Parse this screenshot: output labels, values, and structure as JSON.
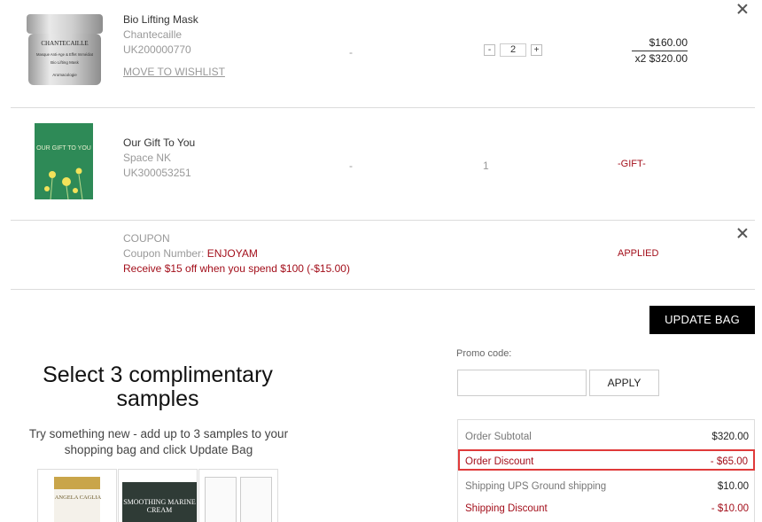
{
  "items": [
    {
      "name": "Bio Lifting Mask",
      "brand": "Chantecaille",
      "sku": "UK200000770",
      "wishlist_link": "MOVE TO WISHLIST",
      "dash": "-",
      "qty_minus": "-",
      "qty": "2",
      "qty_plus": "+",
      "unit_price": "$160.00",
      "total_price": "x2 $320.00",
      "jar_brand": "CHANTECAILLE",
      "jar_text1": "Masque Anti-Age & Effet Immédiat",
      "jar_text2": "Bio Lifting Mask",
      "jar_text3": "Aromacologie"
    },
    {
      "name": "Our Gift To You",
      "brand": "Space NK",
      "sku": "UK300053251",
      "dash": "-",
      "qty": "1",
      "price_label": "-GIFT-",
      "card_text": "OUR GIFT TO YOU"
    }
  ],
  "coupon": {
    "title": "COUPON",
    "number_label": "Coupon Number: ",
    "number": "ENJOYAM",
    "description": "Receive $15 off when you spend $100 (-$15.00)",
    "status": "APPLIED"
  },
  "update_bag": "UPDATE BAG",
  "samples": {
    "title": "Select 3 complimentary samples",
    "description": "Try something new - add up to 3 samples to your shopping bag and click Update Bag",
    "tile1_text": "ANGELA CAGLIA",
    "tile2_text": "SMOOTHING MARINE CREAM"
  },
  "promo": {
    "label": "Promo code:",
    "placeholder": "",
    "apply": "APPLY"
  },
  "summary": {
    "subtotal_label": "Order Subtotal",
    "subtotal_value": "$320.00",
    "discount_label": "Order Discount",
    "discount_value": "- $65.00",
    "shipping_label": "Shipping UPS Ground shipping",
    "shipping_value": "$10.00",
    "shipping_discount_label": "Shipping Discount",
    "shipping_discount_value": "- $10.00"
  },
  "colors": {
    "accent_red": "#a30f1b",
    "highlight_border": "#e03a3a",
    "button_black": "#000000"
  }
}
